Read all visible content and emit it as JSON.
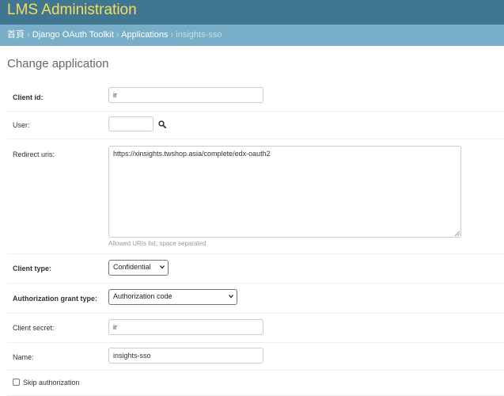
{
  "header": {
    "site_title": "LMS Administration"
  },
  "breadcrumbs": {
    "home": "首頁",
    "app": "Django OAuth Toolkit",
    "model": "Applications",
    "current": "insights-sso",
    "separator": "›"
  },
  "page": {
    "title": "Change application"
  },
  "form": {
    "client_id": {
      "label": "Client id:",
      "value": "ir"
    },
    "user": {
      "label": "User:",
      "value": "",
      "lookup_icon": "search-icon"
    },
    "redirect_uris": {
      "label": "Redirect uris:",
      "value": "https://xinsights.twshop.asia/complete/edx-oauth2",
      "help": "Allowed URIs list, space separated"
    },
    "client_type": {
      "label": "Client type:",
      "value": "Confidential"
    },
    "grant_type": {
      "label": "Authorization grant type:",
      "value": "Authorization code"
    },
    "client_secret": {
      "label": "Client secret:",
      "value": "ir"
    },
    "name": {
      "label": "Name:",
      "value": "insights-sso"
    },
    "skip_authorization": {
      "label": "Skip authorization",
      "checked": false
    }
  },
  "colors": {
    "header_bg": "#417690",
    "site_title": "#f5dd5d",
    "breadcrumb_bg": "#79aec8"
  }
}
